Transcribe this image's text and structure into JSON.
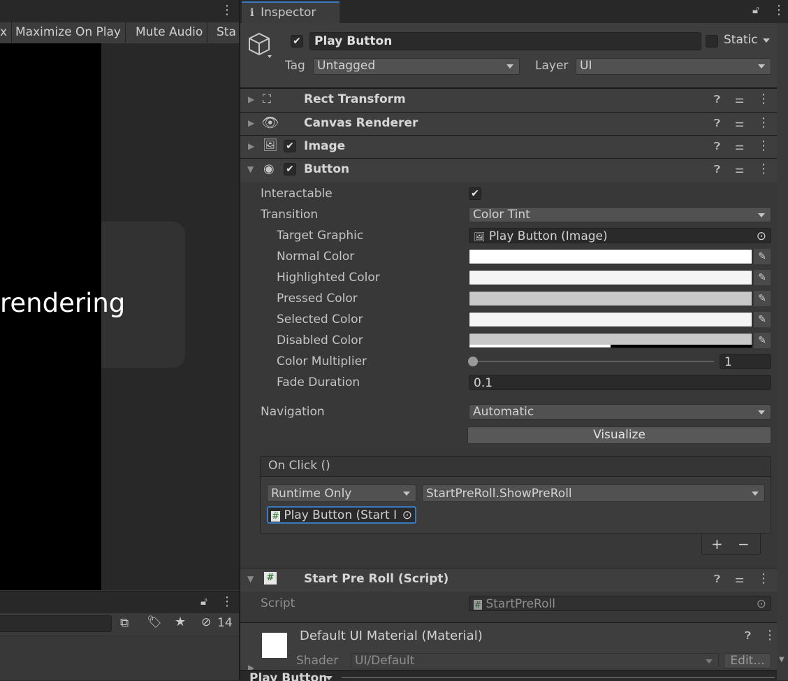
{
  "left_panel": {
    "toolbar": {
      "partial_first": "x",
      "maximize_on_play": "Maximize On Play",
      "mute_audio": "Mute Audio",
      "stats_partial": "Sta"
    },
    "game_text": "rendering",
    "bottom": {
      "hidden_count": "14"
    }
  },
  "inspector": {
    "tab_label": "Inspector",
    "gameobject": {
      "name": "Play Button",
      "active": true,
      "static_label": "Static",
      "tag_label": "Tag",
      "tag_value": "Untagged",
      "layer_label": "Layer",
      "layer_value": "UI"
    },
    "components": [
      {
        "name": "Rect Transform",
        "icon": "rect-transform-icon"
      },
      {
        "name": "Canvas Renderer",
        "icon": "eye-icon"
      },
      {
        "name": "Image",
        "icon": "image-icon",
        "enabled": true
      },
      {
        "name": "Button",
        "icon": "button-icon",
        "enabled": true
      }
    ],
    "button": {
      "interactable_label": "Interactable",
      "interactable": true,
      "transition_label": "Transition",
      "transition_value": "Color Tint",
      "target_graphic_label": "Target Graphic",
      "target_graphic_value": "Play Button (Image)",
      "normal_color_label": "Normal Color",
      "highlighted_color_label": "Highlighted Color",
      "pressed_color_label": "Pressed Color",
      "selected_color_label": "Selected Color",
      "disabled_color_label": "Disabled Color",
      "colors": {
        "normal": "#ffffff",
        "highlighted": "#f5f5f5",
        "pressed": "#c8c8c8",
        "selected": "#f5f5f5",
        "disabled": "#c8c8c8"
      },
      "color_multiplier_label": "Color Multiplier",
      "color_multiplier_value": "1",
      "fade_duration_label": "Fade Duration",
      "fade_duration_value": "0.1",
      "navigation_label": "Navigation",
      "navigation_value": "Automatic",
      "visualize_label": "Visualize",
      "on_click_label": "On Click ()",
      "runtime_value": "Runtime Only",
      "function_value": "StartPreRoll.ShowPreRoll",
      "target_object": "Play Button (Start I",
      "add_label": "+",
      "remove_label": "−"
    },
    "script_component": {
      "name": "Start Pre Roll (Script)",
      "script_label": "Script",
      "script_value": "StartPreRoll"
    },
    "material": {
      "name": "Default UI Material (Material)",
      "shader_label": "Shader",
      "shader_value": "UI/Default",
      "edit_label": "Edit..."
    },
    "footer_label": "Play Button"
  },
  "colors": {
    "accent_tab": "#3a79bb",
    "selection_outline": "#3a79bb"
  }
}
